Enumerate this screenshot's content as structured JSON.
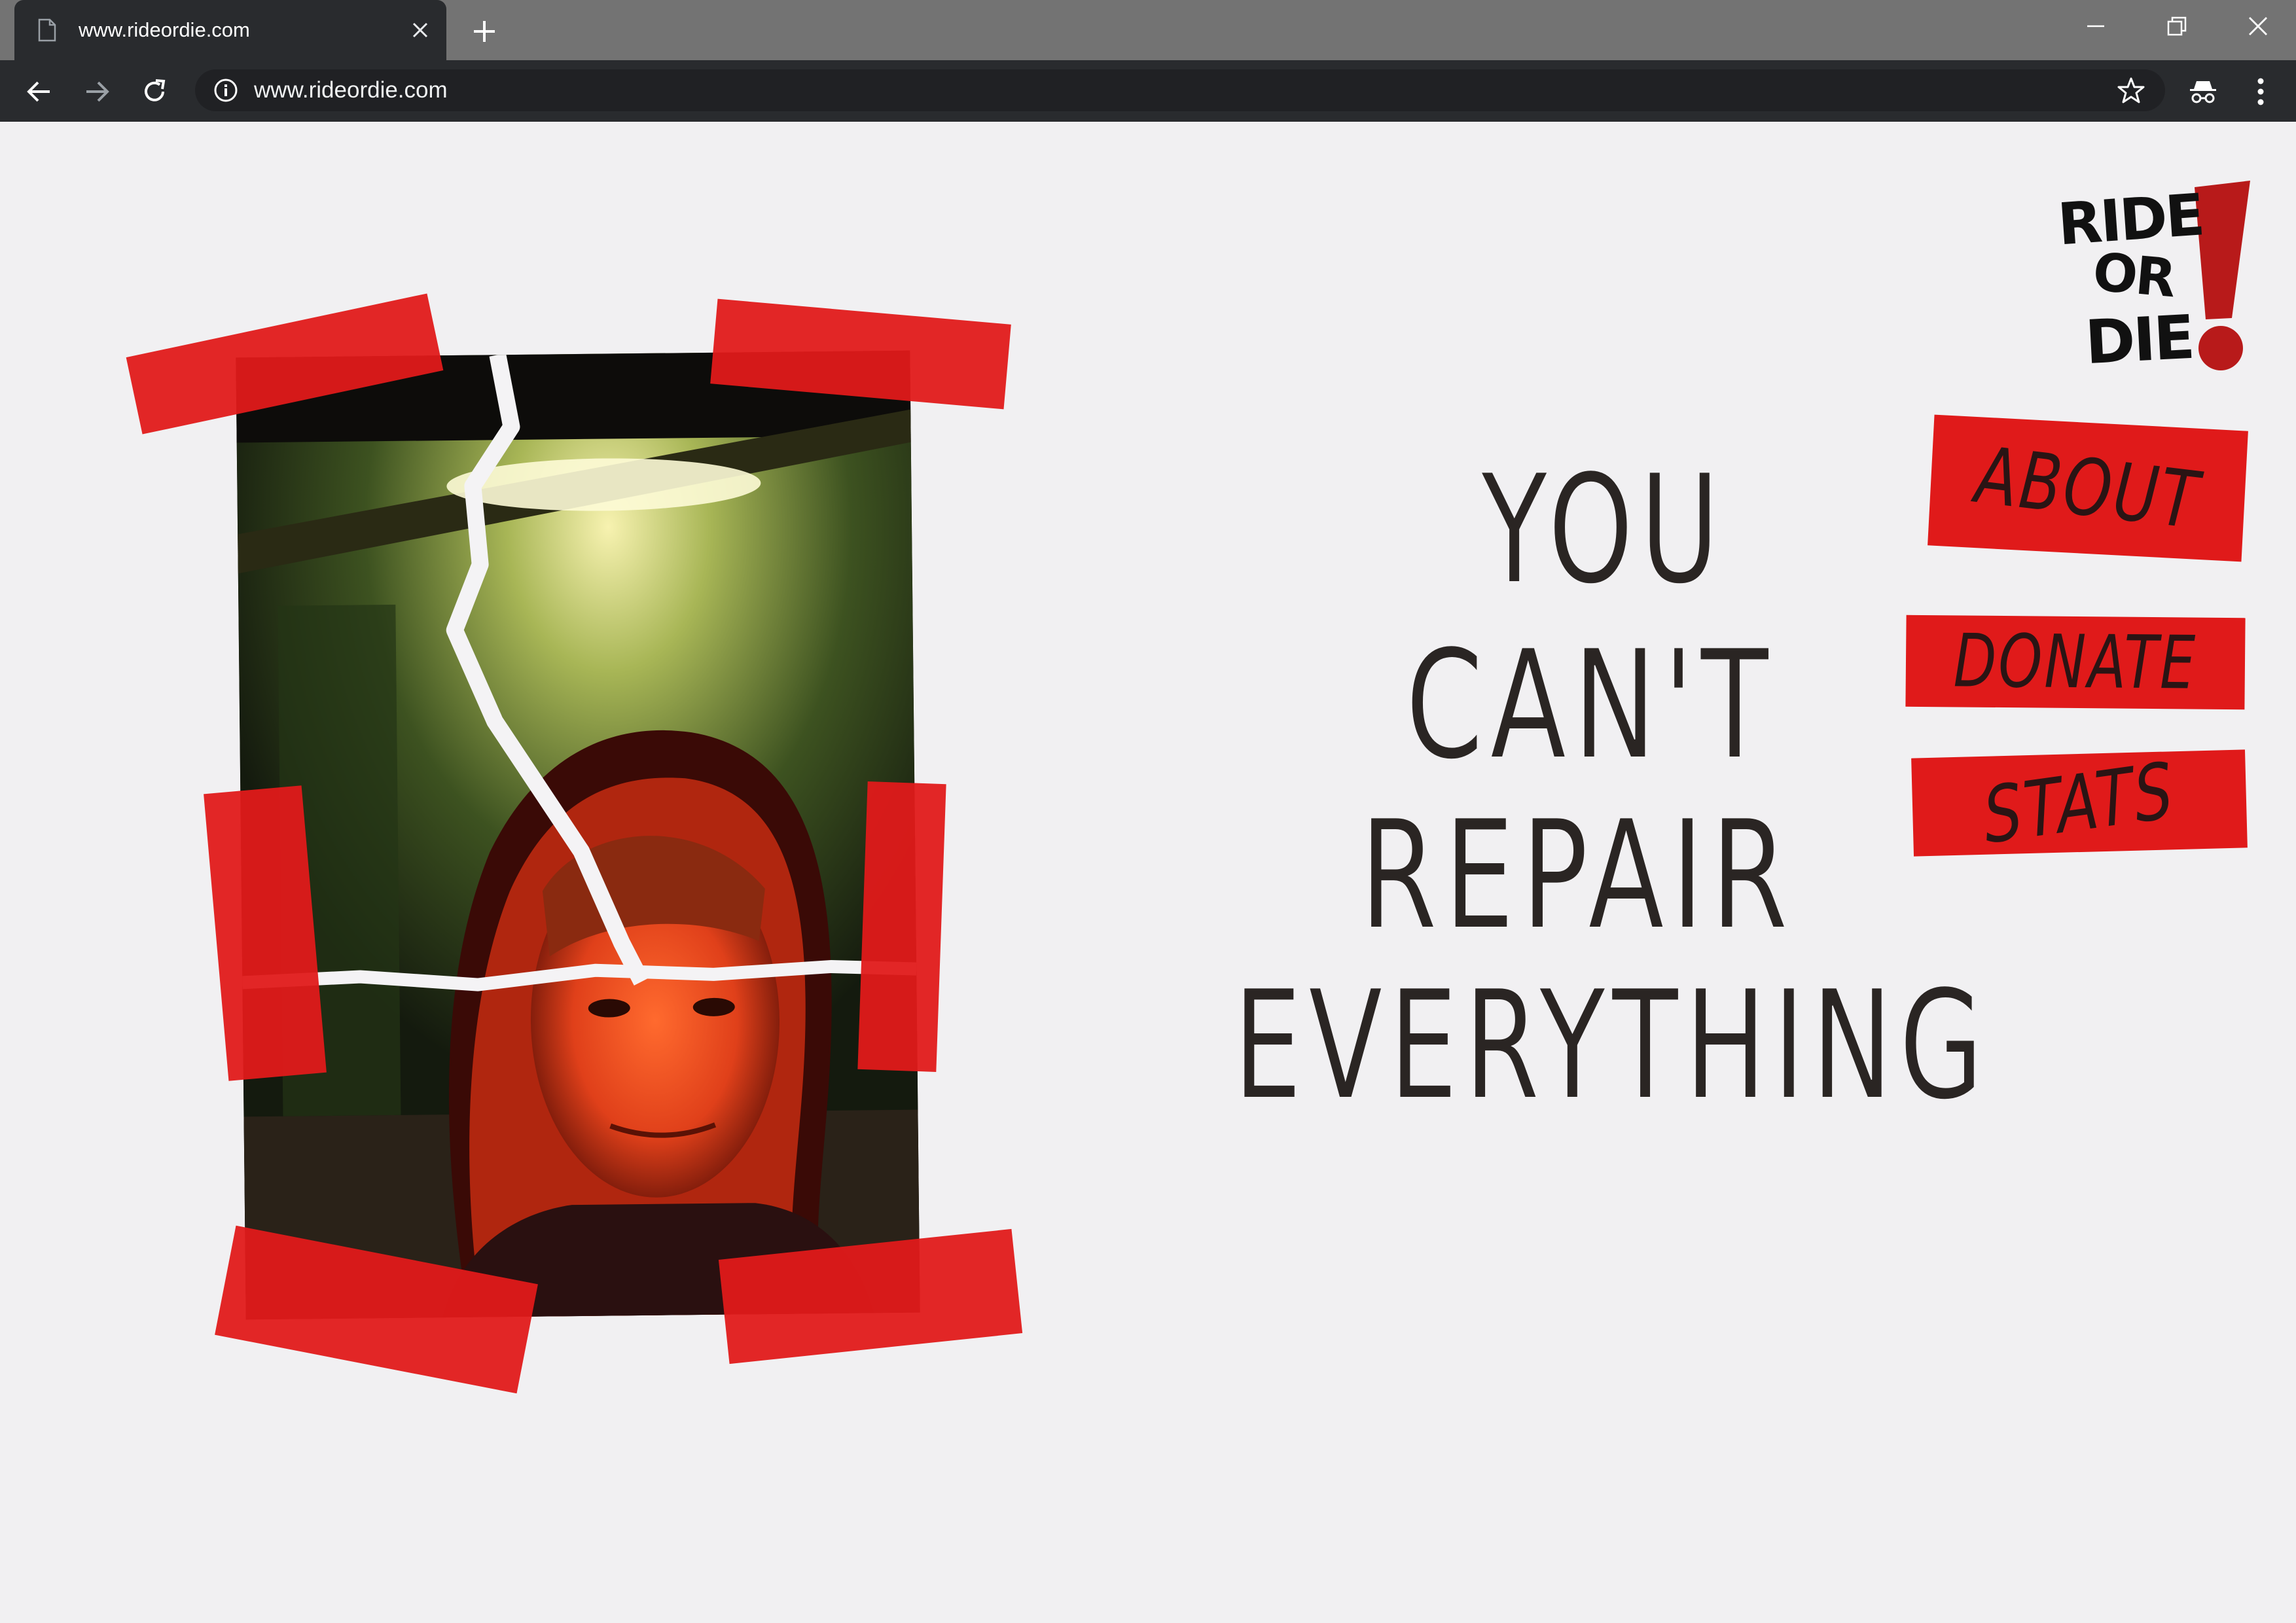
{
  "browser": {
    "tab_title": "www.rideordie.com",
    "url": "www.rideordie.com"
  },
  "logo": {
    "line1": "RIDE",
    "line2": "OR",
    "line3": "DIE",
    "mark": "!"
  },
  "headline": {
    "line1": "YOU",
    "line2": "CAN'T",
    "line3": "REPAIR",
    "line4": "EVERYTHING"
  },
  "nav": {
    "about": "ABOUT",
    "donate": "DONATE",
    "stats": "STATS"
  },
  "colors": {
    "page_background": "#f1f0f2",
    "tape_red": "#e01a1a",
    "ink": "#2a2523",
    "chrome_dark": "#292b2e",
    "chrome_tabbar": "#737373"
  },
  "icons": {
    "tab": "page-icon",
    "tab_close": "close-icon",
    "new_tab": "plus-icon",
    "back": "arrow-left-icon",
    "forward": "arrow-right-icon",
    "reload": "reload-icon",
    "site_info": "info-icon",
    "bookmark": "star-icon",
    "incognito": "incognito-icon",
    "menu": "kebab-menu-icon"
  }
}
